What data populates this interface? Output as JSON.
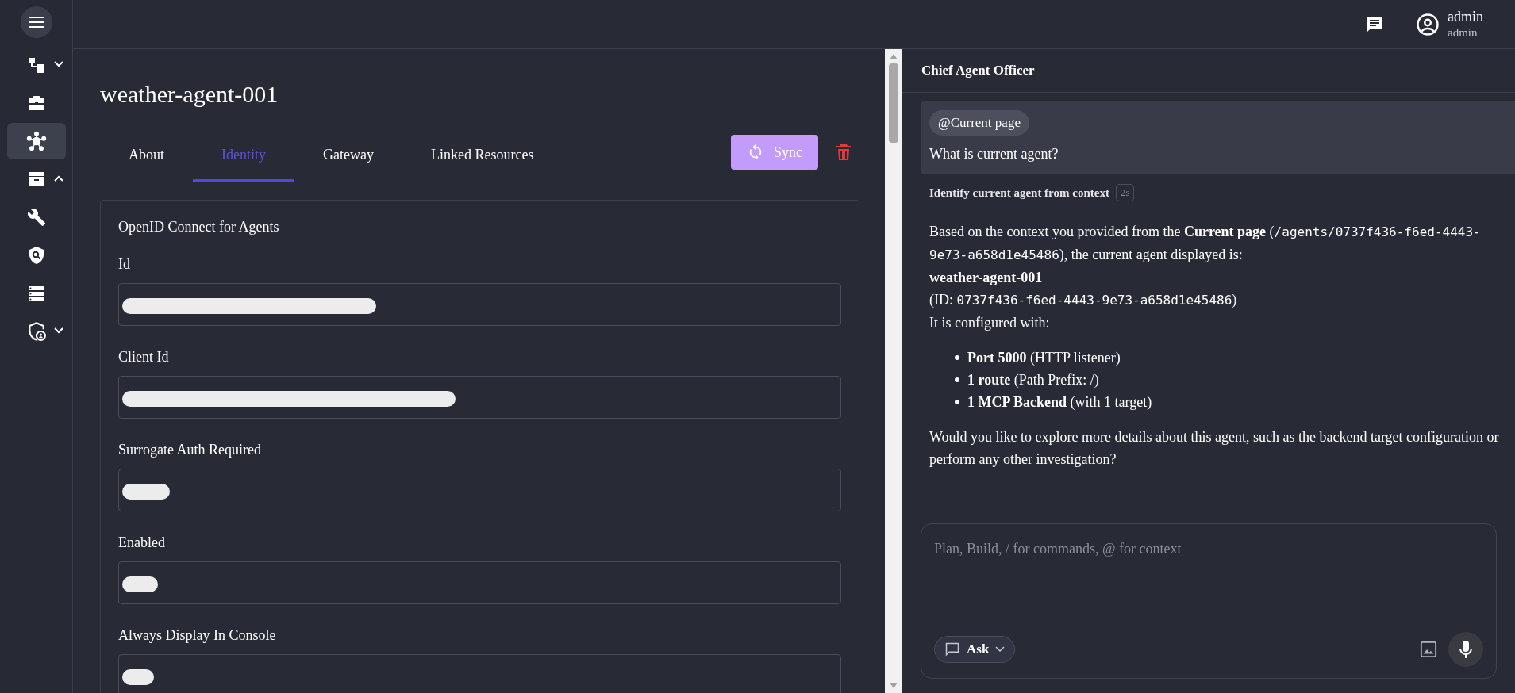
{
  "sidebar": {
    "items": [
      {
        "kind": "group",
        "expanded": false,
        "selected": false
      },
      {
        "kind": "link",
        "selected": false
      },
      {
        "kind": "link",
        "selected": true
      },
      {
        "kind": "group",
        "expanded": true,
        "selected": false
      },
      {
        "kind": "link",
        "selected": false
      },
      {
        "kind": "link",
        "selected": false
      },
      {
        "kind": "link",
        "selected": false
      },
      {
        "kind": "group",
        "expanded": false,
        "selected": false
      }
    ]
  },
  "header": {
    "user_name": "admin",
    "user_role": "admin"
  },
  "page": {
    "title": "weather-agent-001",
    "tabs": [
      {
        "label": "About",
        "selected": false
      },
      {
        "label": "Identity",
        "selected": true
      },
      {
        "label": "Gateway",
        "selected": false
      },
      {
        "label": "Linked Resources",
        "selected": false
      }
    ],
    "sync_button": "Sync",
    "card": {
      "title": "OpenID Connect for Agents",
      "fields": [
        {
          "label": "Id",
          "redacted": true
        },
        {
          "label": "Client Id",
          "redacted": true
        },
        {
          "label": "Surrogate Auth Required",
          "redacted": true
        },
        {
          "label": "Enabled",
          "redacted": true
        },
        {
          "label": "Always Display In Console",
          "redacted": true
        }
      ]
    }
  },
  "chat": {
    "title": "Chief Agent Officer",
    "user_message": {
      "context_chip": "@Current page",
      "text": "What is current agent?"
    },
    "step": {
      "label": "Identify current agent from context",
      "duration": "2s"
    },
    "answer": {
      "intro": [
        {
          "kind": "text",
          "text": "Based on the context you provided from the "
        },
        {
          "kind": "bold",
          "text": "Current page"
        },
        {
          "kind": "text",
          "text": " ("
        },
        {
          "kind": "code",
          "text": "/agents/0737f436-f6ed-4443-9e73-a658d1e45486"
        },
        {
          "kind": "text",
          "text": "), the current agent displayed is:"
        }
      ],
      "name": "weather-agent-001",
      "id_line": [
        {
          "kind": "text",
          "text": "(ID: "
        },
        {
          "kind": "code",
          "text": "0737f436-f6ed-4443-9e73-a658d1e45486"
        },
        {
          "kind": "text",
          "text": ")"
        }
      ],
      "config_intro": "It is configured with:",
      "bullets": [
        "**Port 5000** (HTTP listener)",
        "**1 route** (Path Prefix: /)",
        "**1 MCP Backend** (with 1 target)"
      ],
      "closing": "Would you like to explore more details about this agent, such as the backend target configuration or perform any other investigation?"
    },
    "input": {
      "placeholder": "Plan, Build, / for commands, @ for context",
      "mode": "Ask"
    }
  }
}
